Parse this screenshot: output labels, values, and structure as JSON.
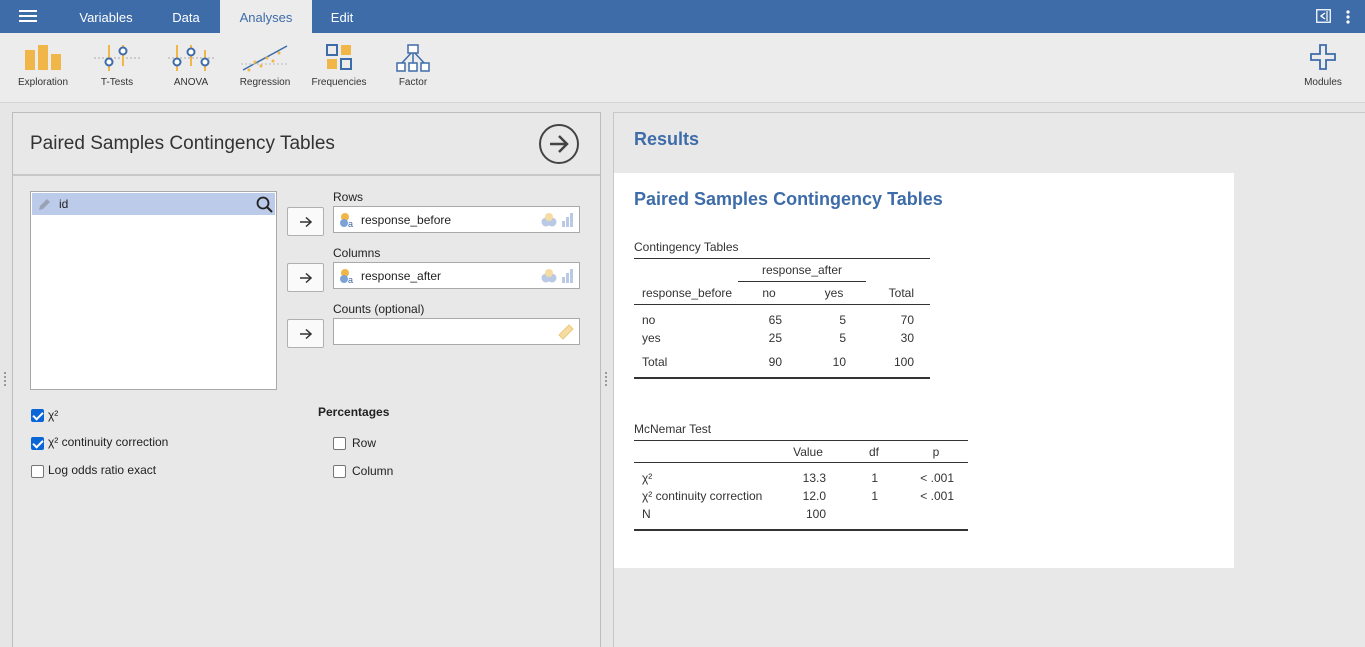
{
  "nav": {
    "tabs": [
      {
        "label": "Variables"
      },
      {
        "label": "Data"
      },
      {
        "label": "Analyses"
      },
      {
        "label": "Edit"
      }
    ],
    "active_tab": "Analyses"
  },
  "ribbon": {
    "buttons": [
      {
        "label": "Exploration",
        "icon": "exploration-icon"
      },
      {
        "label": "T-Tests",
        "icon": "t-tests-icon"
      },
      {
        "label": "ANOVA",
        "icon": "anova-icon"
      },
      {
        "label": "Regression",
        "icon": "regression-icon"
      },
      {
        "label": "Frequencies",
        "icon": "frequencies-icon"
      },
      {
        "label": "Factor",
        "icon": "factor-icon"
      }
    ],
    "modules_label": "Modules"
  },
  "options": {
    "title": "Paired Samples Contingency Tables",
    "variables": [
      {
        "name": "id",
        "selected": true
      }
    ],
    "rows_label": "Rows",
    "rows_value": "response_before",
    "columns_label": "Columns",
    "columns_value": "response_after",
    "counts_label": "Counts (optional)",
    "counts_value": "",
    "checks": [
      {
        "label": "χ²",
        "checked": true
      },
      {
        "label": "χ² continuity correction",
        "checked": true
      },
      {
        "label": "Log odds ratio exact",
        "checked": false
      }
    ],
    "percentages_label": "Percentages",
    "percentages": [
      {
        "label": "Row",
        "checked": false
      },
      {
        "label": "Column",
        "checked": false
      }
    ]
  },
  "results": {
    "heading": "Results",
    "analysis_title": "Paired Samples Contingency Tables",
    "contingency": {
      "caption": "Contingency Tables",
      "spanner": "response_after",
      "headers": [
        "response_before",
        "no",
        "yes",
        "Total"
      ],
      "rows": [
        [
          "no",
          "65",
          "5",
          "70"
        ],
        [
          "yes",
          "25",
          "5",
          "30"
        ],
        [
          "Total",
          "90",
          "10",
          "100"
        ]
      ]
    },
    "mcnemar": {
      "caption": "McNemar Test",
      "headers": [
        "",
        "Value",
        "df",
        "p"
      ],
      "rows": [
        [
          "χ²",
          "13.3",
          "1",
          "< .001"
        ],
        [
          "χ² continuity correction",
          "12.0",
          "1",
          "< .001"
        ],
        [
          "N",
          "100",
          "",
          ""
        ]
      ]
    }
  },
  "colors": {
    "brand": "#3e6ca9",
    "selection": "#bccbe9",
    "checkbox": "#0a66d6"
  }
}
